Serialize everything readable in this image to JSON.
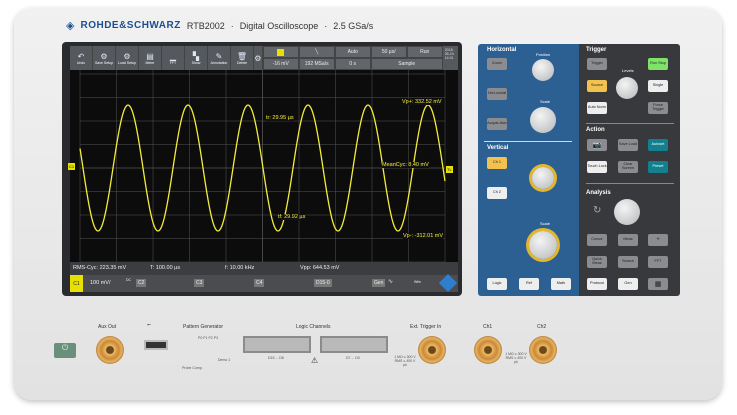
{
  "header": {
    "brand": "ROHDE&SCHWARZ",
    "model": "RTB2002",
    "product": "Digital Oscilloscope",
    "rate": "2.5 GSa/s"
  },
  "toolbar": {
    "buttons": [
      {
        "label": "Undo",
        "icon": "undo-icon"
      },
      {
        "label": "Save Setup",
        "icon": "save-setup-icon"
      },
      {
        "label": "Load Setup",
        "icon": "load-setup-icon"
      },
      {
        "label": "Meter",
        "icon": "meter-icon"
      },
      {
        "label": "FFT",
        "icon": "fft-icon"
      },
      {
        "label": "Show",
        "icon": "show-icon"
      },
      {
        "label": "Annotation",
        "icon": "pencil-icon"
      },
      {
        "label": "Delete",
        "icon": "trash-icon"
      }
    ],
    "trigger_level": "-16 mV",
    "sample_rate": "192 MSa/s",
    "mode": "Auto",
    "time_scale": "50 µs/",
    "delay": "0 s",
    "run_state": "Run",
    "acquisition": "Sample",
    "datetime": "2018-05-24 14:01",
    "trigger_color": "#e8e000"
  },
  "measurements": {
    "vp_plus": "Vp+: 332.52 mV",
    "tr": "tr: 29.95 µs",
    "mean": "MeanCyc: 8.40 mV",
    "tf": "tf: 29.92 µs",
    "vp_minus": "Vp-: -312.01 mV",
    "marker": "TL",
    "ch_marker": "C1"
  },
  "info": {
    "rms": "RMS-Cyc: 223.35 mV",
    "period": "T: 100.00 µs",
    "freq": "f: 10.00 kHz",
    "vpp": "Vpp: 644.53 mV"
  },
  "channels": {
    "c1": "C1",
    "c1_scale": "100 mV/",
    "coupling": "DC",
    "c2": "C2",
    "c3": "C3",
    "c4": "C4",
    "d": "D15-0",
    "gen": "Gen",
    "gen_info": "Wfm",
    "waveform_color": "#f2ec3a"
  },
  "horizontal": {
    "title": "Horizontal",
    "zoom": "Zoom",
    "horizontal": "Hori-zontal",
    "acquisition": "Acquis-ition",
    "position": "Position",
    "scale": "Scale"
  },
  "vertical": {
    "title": "Vertical",
    "ch1": "Ch 1",
    "ch2": "Ch 2",
    "scale": "Scale",
    "logic": "Logic",
    "ref": "Ref",
    "math": "Math"
  },
  "trigger": {
    "title": "Trigger",
    "trigger": "Trigger",
    "source": "Source",
    "auto_norm": "Auto Norm",
    "level": "Levels",
    "run_stop": "Run Stop",
    "single": "Single",
    "force": "Force Trigger"
  },
  "action": {
    "title": "Action",
    "screenshot": "Screenshot",
    "save_load": "Save Load",
    "autoset": "Autoset",
    "touch_lock": "Touch Lock",
    "clear": "Clear Screen",
    "preset": "Preset"
  },
  "analysis": {
    "title": "Analysis",
    "cursor": "Cursor",
    "meas": "Meas",
    "quick": "Quick Meas",
    "search": "Search",
    "fft": "FFT",
    "protocol": "Protocol",
    "gen": "Gen"
  },
  "front": {
    "aux_out": "Aux Out",
    "pattern_gen": "Pattern Generator",
    "pins": "P0 P1 P2 P3",
    "demo": "Demo 1",
    "probe_comp": "Probe Comp.",
    "logic_channels": "Logic Channels",
    "d_hi": "D15 ... D8",
    "d_lo": "D7 ... D0",
    "ext_trig": "Ext. Trigger In",
    "ch1": "Ch1",
    "ch2": "Ch2",
    "rating": "1 MΩ ≤ 300 V RMS ≤ 400 V pk"
  }
}
